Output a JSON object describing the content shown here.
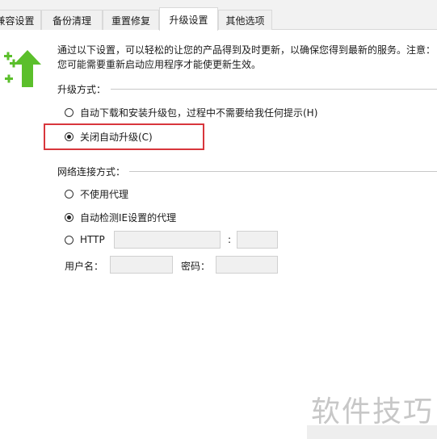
{
  "tabs": [
    {
      "label": "兼容设置"
    },
    {
      "label": "备份清理"
    },
    {
      "label": "重置修复"
    },
    {
      "label": "升级设置"
    },
    {
      "label": "其他选项"
    }
  ],
  "active_tab": "升级设置",
  "description": {
    "line1": "通过以下设置，可以轻松的让您的产品得到及时更新，以确保您得到最新的服务。注意：",
    "line2": "您可能需要重新启动应用程序才能使更新生效。"
  },
  "upgrade_mode": {
    "label": "升级方式：",
    "options": [
      {
        "label": "自动下载和安装升级包，过程中不需要给我任何提示(H)",
        "checked": false
      },
      {
        "label": "关闭自动升级(C)",
        "checked": true
      }
    ]
  },
  "network": {
    "label": "网络连接方式：",
    "options": [
      {
        "label": "不使用代理",
        "checked": false
      },
      {
        "label": "自动检测IE设置的代理",
        "checked": true
      },
      {
        "label": "HTTP",
        "checked": false
      }
    ],
    "port_separator": ":",
    "username_label": "用户名：",
    "password_label": "密码：",
    "http_host_value": "",
    "http_port_value": "",
    "username_value": "",
    "password_value": ""
  },
  "watermark": "软件技巧",
  "icons": {
    "upgrade": "upgrade-arrow-icon"
  },
  "colors": {
    "accent_green": "#5bbf2b",
    "highlight_red": "#d8363c"
  }
}
